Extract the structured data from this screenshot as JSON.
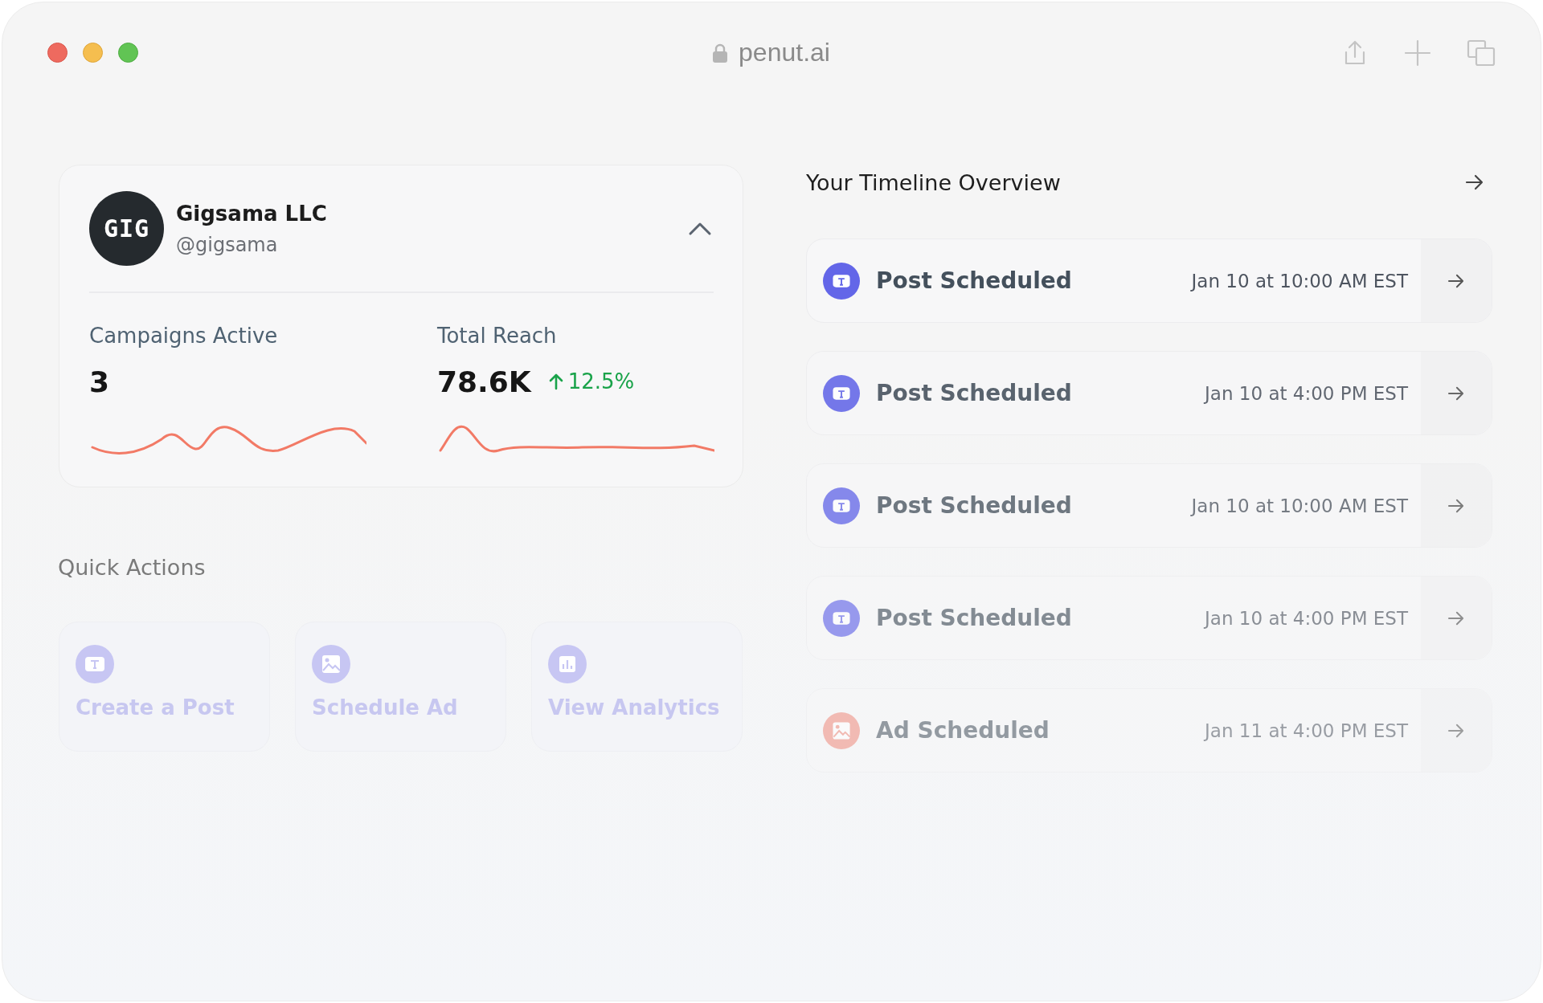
{
  "window": {
    "url": "penut.ai"
  },
  "profile": {
    "avatar_text": "GIG",
    "name": "Gigsama LLC",
    "handle": "@gigsama",
    "expanded": true,
    "stats": [
      {
        "label": "Campaigns Active",
        "value": "3"
      },
      {
        "label": "Total Reach",
        "value": "78.6K",
        "change": "12.5%"
      }
    ]
  },
  "quick_actions": {
    "title": "Quick Actions",
    "items": [
      {
        "kind": "post",
        "label": "Create a Post"
      },
      {
        "kind": "ad",
        "label": "Schedule Ad"
      },
      {
        "kind": "analytics",
        "label": "View Analytics"
      }
    ]
  },
  "timeline": {
    "title": "Your Timeline Overview",
    "items": [
      {
        "kind": "post",
        "title": "Post Scheduled",
        "time": "Jan 10 at 10:00 AM EST"
      },
      {
        "kind": "post",
        "title": "Post Scheduled",
        "time": "Jan 10 at 4:00 PM EST"
      },
      {
        "kind": "post",
        "title": "Post Scheduled",
        "time": "Jan 10 at 10:00 AM EST"
      },
      {
        "kind": "post",
        "title": "Post Scheduled",
        "time": "Jan 10 at 4:00 PM EST"
      },
      {
        "kind": "ad",
        "title": "Ad Scheduled",
        "time": "Jan 11 at 4:00 PM EST"
      }
    ]
  }
}
